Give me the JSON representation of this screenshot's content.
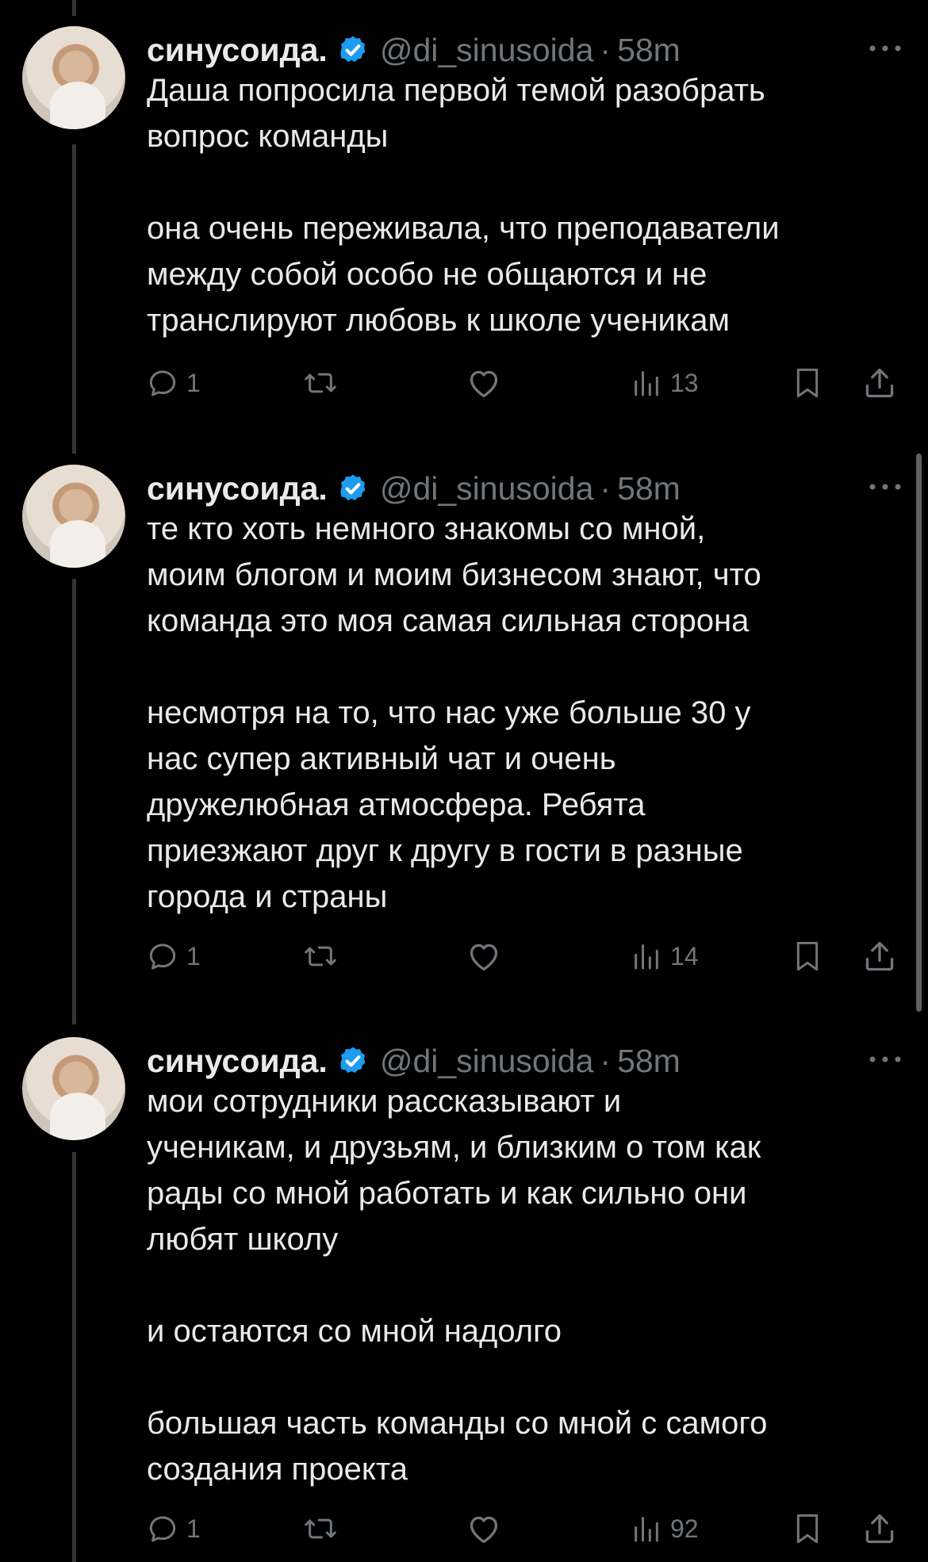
{
  "colors": {
    "background": "#000000",
    "text": "#e7e9ea",
    "muted": "#71767b",
    "verified": "#1d9bf0",
    "thread_line": "#333639"
  },
  "tweets": [
    {
      "name": "синусоида.",
      "handle": "@di_sinusoida",
      "separator": "·",
      "time": "58m",
      "paragraphs": [
        "Даша попросила первой темой разобрать\nвопрос команды",
        "она очень переживала, что преподаватели\nмежду собой особо не общаются и не\nтранслируют любовь к школе ученикам"
      ],
      "replies": "1",
      "views": "13"
    },
    {
      "name": "синусоида.",
      "handle": "@di_sinusoida",
      "separator": "·",
      "time": "58m",
      "paragraphs": [
        "те кто хоть немного знакомы со мной,\nмоим блогом и моим бизнесом знают, что\nкоманда это моя самая сильная сторона",
        "несмотря на то, что нас уже больше 30 у\nнас супер активный чат и очень\nдружелюбная атмосфера. Ребята\nприезжают друг к другу в гости в разные\nгорода и страны"
      ],
      "replies": "1",
      "views": "14"
    },
    {
      "name": "синусоида.",
      "handle": "@di_sinusoida",
      "separator": "·",
      "time": "58m",
      "paragraphs": [
        "мои сотрудники рассказывают и\nученикам, и друзьям, и близким о том как\nрады со мной работать и как сильно они\nлюбят школу",
        "и остаются со мной надолго",
        "большая часть команды со мной с самого\nсоздания проекта"
      ],
      "replies": "1",
      "views": "92"
    }
  ]
}
